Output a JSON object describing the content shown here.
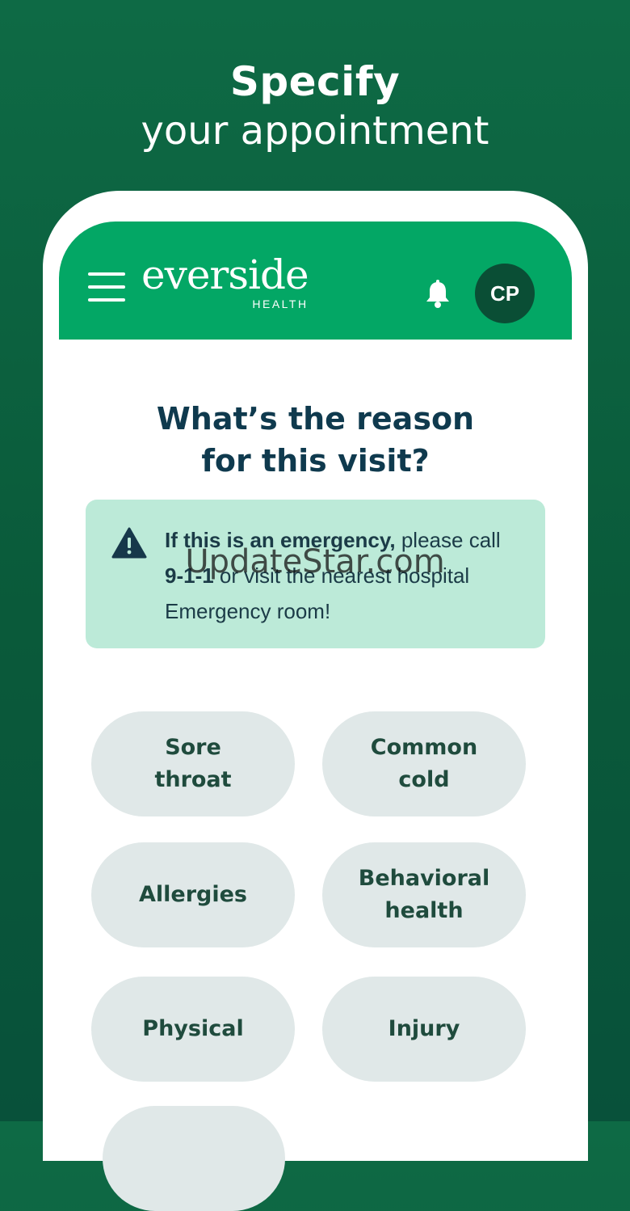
{
  "promo": {
    "title_line1": "Specify",
    "title_line2": "your appointment"
  },
  "header": {
    "logo_text": "everside",
    "logo_sub": "HEALTH",
    "avatar_initials": "CP",
    "menu_icon": "hamburger-menu-icon",
    "bell_icon": "bell-icon",
    "brand_color": "#03a765"
  },
  "main": {
    "question_line1": "What’s the reason",
    "question_line2": "for this visit?",
    "alert": {
      "icon": "warning-triangle-icon",
      "bold_text": "If this is an emergency,",
      "text_1": " please call",
      "bold_number": "9-1-1",
      "text_2": " or visit the nearest hospital",
      "text_3": "Emergency room!",
      "color": "#bcead8"
    },
    "reasons": [
      {
        "line1": "Sore",
        "line2": "throat"
      },
      {
        "line1": "Common",
        "line2": "cold"
      },
      {
        "line1": "Allergies",
        "line2": ""
      },
      {
        "line1": "Behavioral",
        "line2": "health"
      },
      {
        "line1": "Physical",
        "line2": ""
      },
      {
        "line1": "Injury",
        "line2": ""
      }
    ]
  },
  "watermark": "UpdateStar.com"
}
